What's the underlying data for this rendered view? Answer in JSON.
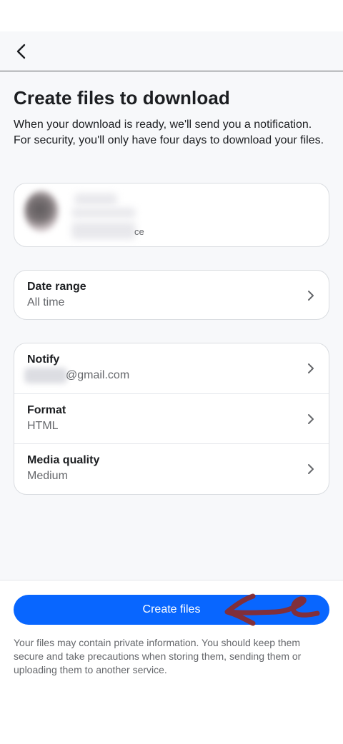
{
  "header": {
    "back_icon": "chevron-left-icon"
  },
  "main": {
    "title": "Create files to download",
    "description": "When your download is ready, we'll send you a notification. For security, you'll only have four days to download your files."
  },
  "account": {
    "name": "",
    "subtitle_visible_suffix": "ce"
  },
  "settings": {
    "date_range": {
      "title": "Date range",
      "value": "All time"
    },
    "notify": {
      "title": "Notify",
      "value": "@gmail.com"
    },
    "format": {
      "title": "Format",
      "value": "HTML"
    },
    "media_quality": {
      "title": "Media quality",
      "value": "Medium"
    }
  },
  "footer": {
    "create_label": "Create files",
    "disclaimer": "Your files may contain private information. You should keep them secure and take precautions when storing them, sending them or uploading them to another service."
  },
  "colors": {
    "accent": "#0866ff",
    "annotation": "#8b2a2a"
  }
}
